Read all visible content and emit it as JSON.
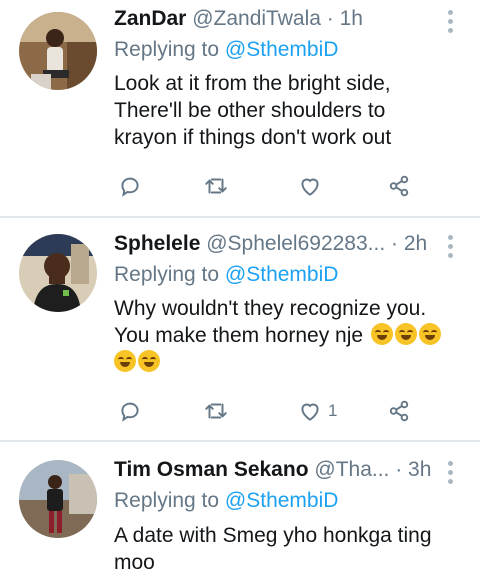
{
  "tweets": [
    {
      "name": "ZanDar",
      "meta": "@ZandiTwala · 1h",
      "replying_prefix": "Replying to ",
      "replying_handle": "@SthembiD",
      "lines": [
        "Look at it from the bright side,",
        "There'll be other shoulders to",
        "krayon if things don't work out"
      ],
      "like_count": ""
    },
    {
      "name": "Sphelele",
      "meta": "@Sphelel692283... · 2h",
      "replying_prefix": "Replying to ",
      "replying_handle": "@SthembiD",
      "lines": [
        "Why wouldn't they recognize you.",
        "You make them horney nje"
      ],
      "emoji_count_line1": 3,
      "emoji_count_line2": 2,
      "emoji_name": "rolling-on-floor-laughing",
      "like_count": "1"
    },
    {
      "name": "Tim Osman Sekano",
      "meta": "@Tha... · 3h",
      "replying_prefix": "Replying to ",
      "replying_handle": "@SthembiD",
      "lines": [
        "A date with Smeg yho honkga ting",
        "moo"
      ],
      "like_count": ""
    }
  ],
  "colors": {
    "link": "#1da1f2",
    "secondary_text": "#657786",
    "icon": "#657786",
    "divider": "#e1e8ed"
  },
  "icons": [
    "reply-icon",
    "retweet-icon",
    "like-icon",
    "share-icon",
    "more-icon"
  ]
}
